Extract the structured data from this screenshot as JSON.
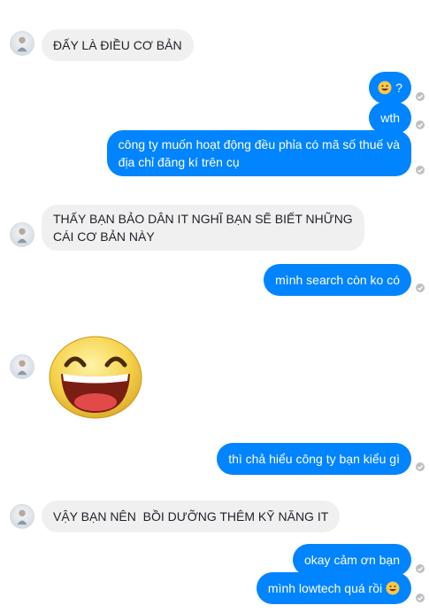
{
  "messages": [
    {
      "side": "in",
      "text": "ĐẤY LÀ ĐIỀU CƠ BẢN"
    },
    {
      "side": "out",
      "text": "?",
      "emoji": "grinning-face"
    },
    {
      "side": "out",
      "text": "wth"
    },
    {
      "side": "out",
      "line1": "công ty muốn hoạt động đều phỉa có mã số thuế và",
      "line2": "địa chỉ đăng kí trên cụ"
    },
    {
      "side": "in",
      "line1": "THẤY BẠN BẢO DÂN IT NGHĨ BẠN SẼ BIẾT NHỮNG",
      "line2": "CÁI CƠ BẢN NÀY"
    },
    {
      "side": "out",
      "text": "mình search còn ko có"
    },
    {
      "side": "in",
      "sticker": "laughing-face-sticker"
    },
    {
      "side": "out",
      "text": "thì chả hiểu công ty bạn kiểu gì"
    },
    {
      "side": "in",
      "text": "VẬY BẠN NÊN  BỒI DƯỠNG THÊM KỸ NĂNG IT"
    },
    {
      "side": "out",
      "text": "okay cảm ơn bạn"
    },
    {
      "side": "out",
      "text": "mình lowtech quá rồi",
      "emoji": "grinning-face"
    }
  ],
  "colors": {
    "outgoing_bubble": "#0084ff",
    "incoming_bubble": "#f1f0f0",
    "seen_tick": "#bcc0c4"
  }
}
